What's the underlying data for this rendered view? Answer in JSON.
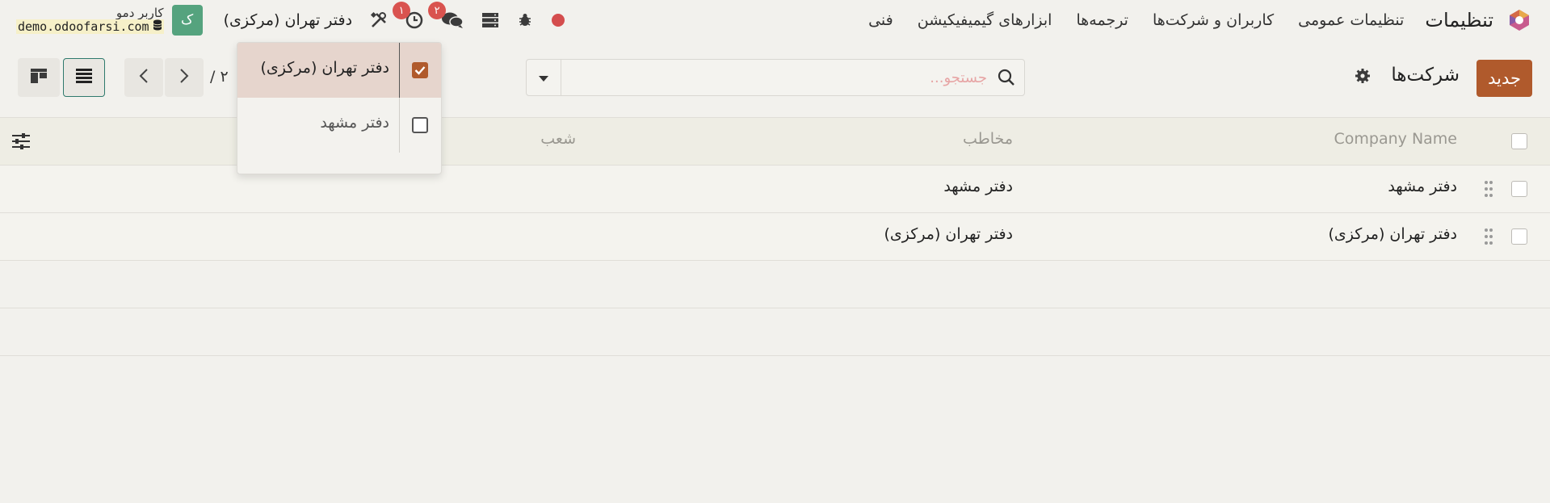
{
  "topbar": {
    "app_title": "تنظیمات",
    "menu": [
      "تنظیمات عمومی",
      "کاربران و شرکت‌ها",
      "ترجمه‌ها",
      "ابزارهای گیمیفیکیشن",
      "فنی"
    ],
    "badges": {
      "activities": "۱",
      "messages": "۲"
    },
    "company_switch": "دفتر تهران (مرکزی)",
    "avatar_letter": "ک",
    "user_name": "کاربر دمو",
    "db_name": "demo.odoofarsi.com"
  },
  "control": {
    "new_label": "جدید",
    "breadcrumb": "شرکت‌ها",
    "search_placeholder": "جستجو...",
    "pager": "/ ۲"
  },
  "table": {
    "headers": {
      "name": "Company Name",
      "contact": "مخاطب",
      "branch": "شعب"
    },
    "rows": [
      {
        "name": "دفتر مشهد",
        "contact": "دفتر مشهد"
      },
      {
        "name": "دفتر تهران (مرکزی)",
        "contact": "دفتر تهران (مرکزی)"
      }
    ]
  },
  "company_dropdown": {
    "items": [
      {
        "label": "دفتر تهران (مرکزی)",
        "checked": true
      },
      {
        "label": "دفتر مشهد",
        "checked": false
      }
    ]
  },
  "colors": {
    "brand": "#b05a2c",
    "avatar": "#55a37e",
    "badge": "#d9534f",
    "accent": "#2f7a6d"
  }
}
